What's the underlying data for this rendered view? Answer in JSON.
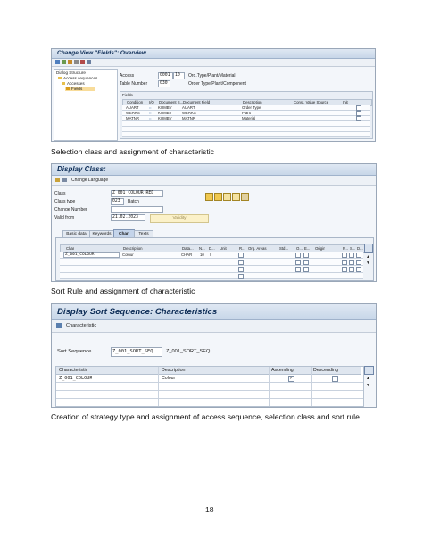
{
  "screen1": {
    "title": "Change View \"Fields\": Overview",
    "nav_header": "Dialog Structure",
    "nav_items": [
      "Access sequences",
      "Accesses",
      "Fields"
    ],
    "access_label": "Access",
    "access_value": "0001",
    "access_code": "10",
    "access_desc": "Ord.Type/Plant/Material",
    "table_label": "Table Number",
    "table_value": "030",
    "table_desc": "Order Type/Plant/Component",
    "fields_header": "Fields",
    "columns": [
      "Condition",
      "I/O",
      "Document S...",
      "Document Field",
      "Description",
      "Const. Value Source",
      "Init"
    ],
    "rows": [
      {
        "condition": "AUART",
        "io": "⇔",
        "doc_s": "KOMBV",
        "doc_field": "AUART",
        "description": "Order Type"
      },
      {
        "condition": "WERKS",
        "io": "⇔",
        "doc_s": "KOMBV",
        "doc_field": "WERKS",
        "description": "Plant"
      },
      {
        "condition": "MATNR",
        "io": "⇔",
        "doc_s": "KOMBV",
        "doc_field": "MATNR",
        "description": "Material"
      }
    ]
  },
  "caption1": "Selection class and assignment of characteristic",
  "screen2": {
    "title": "Display Class:",
    "toolbar_label": "Change Language",
    "class_label": "Class",
    "class_value": "Z_001_COLOUR_RED",
    "class_type_label": "Class type",
    "class_type_value": "023",
    "class_type_desc": "Batch",
    "change_number_label": "Change Number",
    "valid_from_label": "Valid from",
    "valid_from_value": "21.02.2023",
    "validity_button": "Validity",
    "tabs": [
      "Basic data",
      "Keywords",
      "Char.",
      "Texts"
    ],
    "active_tab": "Char.",
    "columns": [
      "Char",
      "Description",
      "Data...",
      "N...",
      "D...",
      "Unit",
      "R...",
      "Org. Areas",
      "Std...",
      "O...",
      "E...",
      "Origin",
      "P...",
      "S...",
      "D..."
    ],
    "rows": [
      {
        "char": "Z_001_COLOUR",
        "description": "Colour",
        "data": "CHAR",
        "n": "10",
        "d": "0"
      }
    ]
  },
  "caption2": "Sort Rule and assignment of characteristic",
  "screen3": {
    "title": "Display Sort Sequence: Characteristics",
    "toolbar_label": "Characteristic",
    "sort_label": "Sort Sequence",
    "sort_value": "Z_001_SORT_SEQ",
    "sort_desc": "Z_001_SORT_SEQ",
    "columns": [
      "Characteristic",
      "Description",
      "Ascending",
      "Descending"
    ],
    "rows": [
      {
        "characteristic": "Z_001_COLOUR",
        "description": "Colour",
        "ascending": true,
        "descending": false
      }
    ]
  },
  "caption3": "Creation of strategy type and assignment of access sequence, selection class and sort rule",
  "page_number": "18",
  "colors": {
    "title_text": "#0b2b55",
    "header_bg": "#dfe6ef",
    "validity_btn": "#fbf1c8"
  }
}
